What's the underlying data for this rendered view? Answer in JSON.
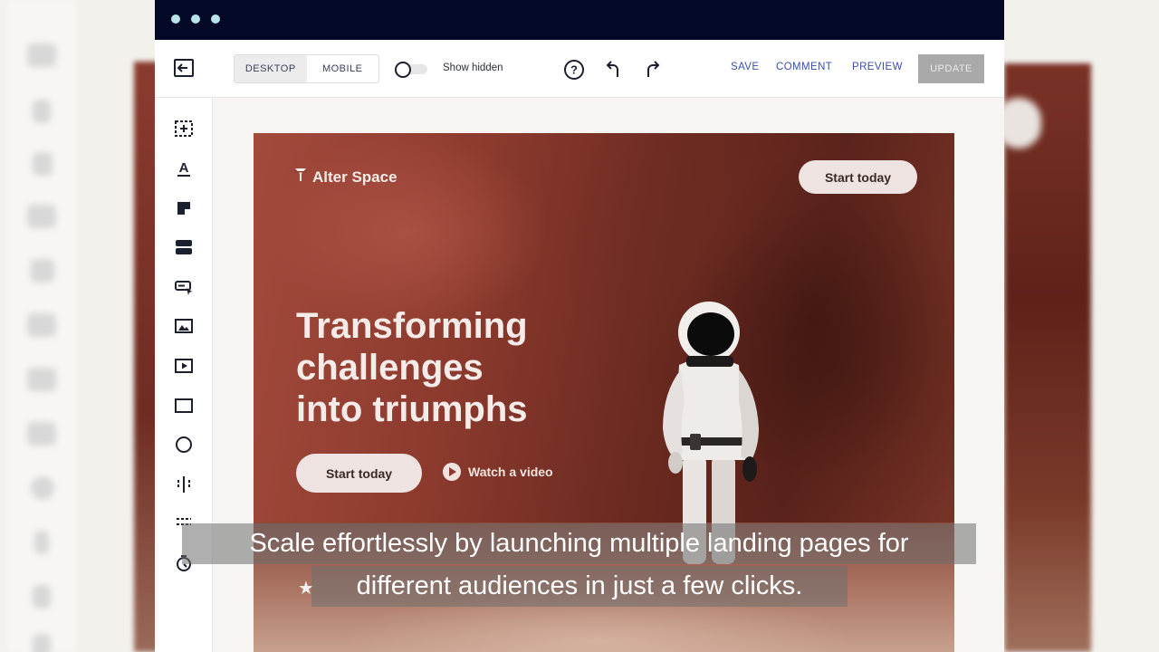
{
  "toolbar": {
    "view_tabs": [
      "DESKTOP",
      "MOBILE"
    ],
    "active_view": "DESKTOP",
    "show_hidden_label": "Show hidden",
    "show_hidden_on": false,
    "save_label": "SAVE",
    "comment_label": "COMMENT",
    "preview_label": "PREVIEW",
    "update_label": "UPDATE"
  },
  "sidebar": {
    "items": [
      {
        "icon": "section-add-icon"
      },
      {
        "icon": "text-icon"
      },
      {
        "icon": "paragraph-icon"
      },
      {
        "icon": "stack-icon"
      },
      {
        "icon": "button-icon"
      },
      {
        "icon": "image-icon"
      },
      {
        "icon": "video-icon"
      },
      {
        "icon": "box-icon"
      },
      {
        "icon": "circle-icon"
      },
      {
        "icon": "columns-icon"
      },
      {
        "icon": "list-icon"
      },
      {
        "icon": "timer-icon"
      }
    ]
  },
  "hero": {
    "logo_text": "Alter Space",
    "top_cta": "Start today",
    "headline": [
      "Transforming",
      "challenges",
      "into triumphs"
    ],
    "primary_cta": "Start today",
    "secondary_cta": "Watch a video"
  },
  "caption": {
    "line1": "Scale effortlessly by launching multiple landing pages for",
    "line2": "different audiences in just a few clicks."
  },
  "colors": {
    "titlebar": "#020826",
    "link": "#3a4fa8",
    "update_disabled": "#a9a9a9"
  }
}
